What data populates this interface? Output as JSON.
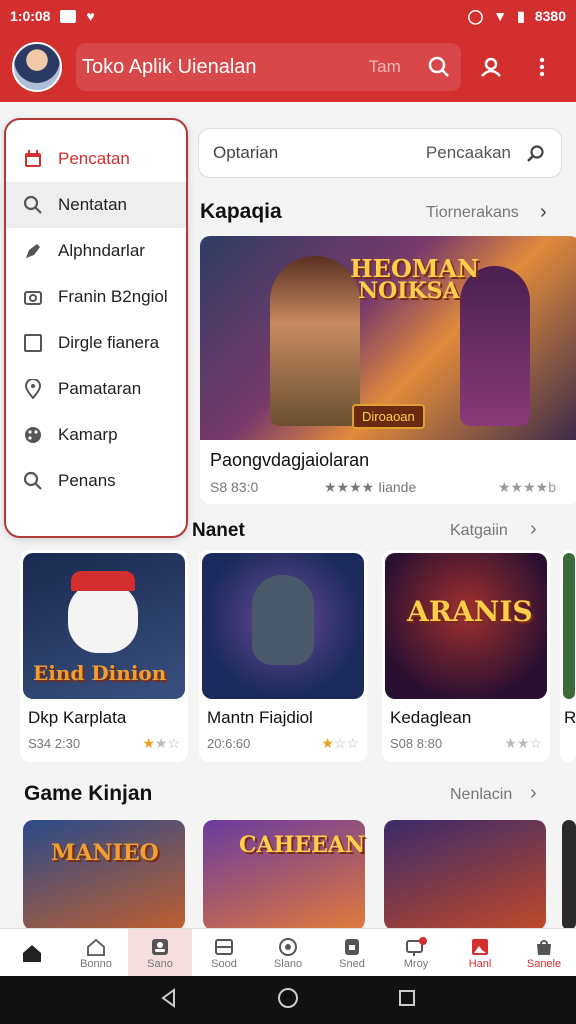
{
  "status_bar": {
    "time": "1:0:08",
    "right_text": "8380"
  },
  "topbar": {
    "title": "Toko Aplik Uienalan",
    "hint": "Tam"
  },
  "drawer": {
    "items": [
      {
        "label": "Pencatan",
        "icon": "calendar-icon"
      },
      {
        "label": "Nentatan",
        "icon": "search-icon"
      },
      {
        "label": "Alphndarlar",
        "icon": "pencil-icon"
      },
      {
        "label": "Franin B2ngiol",
        "icon": "camera-icon"
      },
      {
        "label": "Dirgle fianera",
        "icon": "square-icon"
      },
      {
        "label": "Pamataran",
        "icon": "location-icon"
      },
      {
        "label": "Kamarp",
        "icon": "palette-icon"
      },
      {
        "label": "Penans",
        "icon": "search-icon"
      }
    ]
  },
  "filter": {
    "left": "Optarian",
    "right": "Pencaakan"
  },
  "featured_section": {
    "title": "Kapaqia",
    "more": "Tiornerakans",
    "banner_title_1": "HEOMAN",
    "banner_title_2": "NOIKSA",
    "banner_sub": "Diroaoan",
    "name": "Paongvdagjaiolaran",
    "meta": "S8 83:0",
    "meta2": "★★★★ Iiande",
    "meta3": "★★★★b"
  },
  "section2": {
    "title": "Nanet",
    "more": "Katgaiin",
    "cards": [
      {
        "name": "Dkp Karplata",
        "meta": "S34 2:30",
        "art_text": "Eind Dinion"
      },
      {
        "name": "Mantn Fiajdiol",
        "meta": "20:6:60",
        "art_text": ""
      },
      {
        "name": "Kedaglean",
        "meta": "S08 8:80",
        "art_text": "ARANIS"
      },
      {
        "name": "R",
        "meta": "",
        "art_text": ""
      }
    ]
  },
  "section3": {
    "title": "Game Kinjan",
    "more": "Nenlacin",
    "art_texts": [
      "MANIEO",
      "CAHEEAN",
      ""
    ]
  },
  "bottom_nav": [
    {
      "label": "",
      "icon": "home-icon"
    },
    {
      "label": "Bonno",
      "icon": "house-icon"
    },
    {
      "label": "Sano",
      "icon": "person-icon"
    },
    {
      "label": "Sood",
      "icon": "grid-icon"
    },
    {
      "label": "Slano",
      "icon": "gamepad-icon"
    },
    {
      "label": "Sned",
      "icon": "lock-icon"
    },
    {
      "label": "Mroy",
      "icon": "tv-icon"
    },
    {
      "label": "Hanl",
      "icon": "image-icon"
    },
    {
      "label": "Sanele",
      "icon": "bag-icon"
    }
  ]
}
